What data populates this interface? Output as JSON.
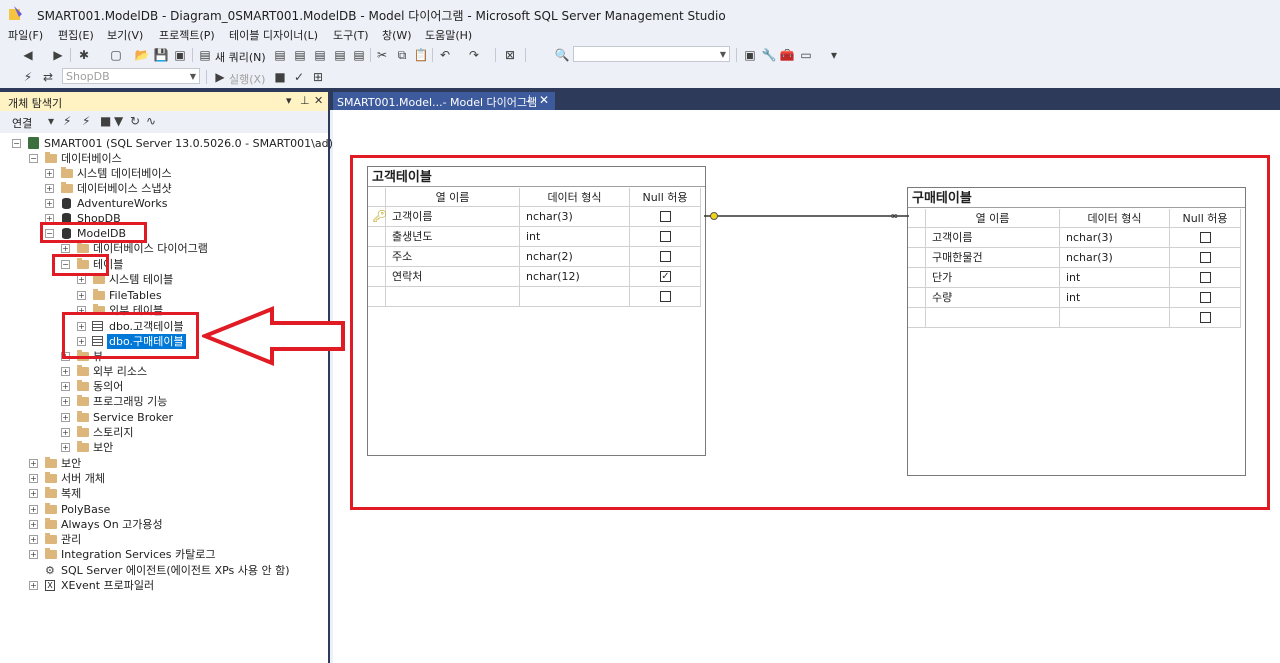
{
  "window": {
    "title": "SMART001.ModelDB - Diagram_0SMART001.ModelDB - Model 다이어그램 - Microsoft SQL Server Management Studio"
  },
  "menu": [
    "파일(F)",
    "편집(E)",
    "보기(V)",
    "프로젝트(P)",
    "테이블 디자이너(L)",
    "도구(T)",
    "창(W)",
    "도움말(H)"
  ],
  "toolbar": {
    "new_query": "새 쿼리(N)",
    "db_combo": "ShopDB",
    "execute": "실행(X)"
  },
  "explorer": {
    "title": "개체 탐색기",
    "connect_label": "연결",
    "server": "SMART001 (SQL Server 13.0.5026.0 - SMART001\\ad)",
    "nodes": {
      "databases": "데이터베이스",
      "system_db": "시스템 데이터베이스",
      "db_snapshot": "데이터베이스 스냅샷",
      "adventureworks": "AdventureWorks",
      "shopdb": "ShopDB",
      "modeldb": "ModelDB",
      "db_diagram": "데이터베이스 다이어그램",
      "tables": "테이블",
      "system_tables": "시스템 테이블",
      "filetables": "FileTables",
      "external_tables": "외부 테이블",
      "dbo_customer": "dbo.고객테이블",
      "dbo_purchase": "dbo.구매테이블",
      "views": "뷰",
      "external_resources": "외부 리소스",
      "synonyms": "동의어",
      "programmability": "프로그래밍 기능",
      "service_broker": "Service Broker",
      "storage": "스토리지",
      "security_db": "보안",
      "security": "보안",
      "server_objects": "서버 개체",
      "replication": "복제",
      "polybase": "PolyBase",
      "always_on": "Always On 고가용성",
      "management": "관리",
      "integration_services": "Integration Services 카탈로그",
      "sql_agent": "SQL Server 에이전트(에이전트 XPs 사용 안 함)",
      "xevent": "XEvent 프로파일러"
    }
  },
  "doc_tab": {
    "label": "SMART001.Model...- Model 다이어그램"
  },
  "diagram": {
    "columns_header": {
      "name": "열 이름",
      "type": "데이터 형식",
      "nullable": "Null 허용"
    },
    "customer_table": {
      "title": "고객테이블",
      "rows": [
        {
          "name": "고객이름",
          "type": "nchar(3)",
          "null": false,
          "pk": true
        },
        {
          "name": "출생년도",
          "type": "int",
          "null": false,
          "pk": false
        },
        {
          "name": "주소",
          "type": "nchar(2)",
          "null": false,
          "pk": false
        },
        {
          "name": "연락처",
          "type": "nchar(12)",
          "null": true,
          "pk": false
        }
      ]
    },
    "purchase_table": {
      "title": "구매테이블",
      "rows": [
        {
          "name": "고객이름",
          "type": "nchar(3)",
          "null": false
        },
        {
          "name": "구매한물건",
          "type": "nchar(3)",
          "null": false
        },
        {
          "name": "단가",
          "type": "int",
          "null": false
        },
        {
          "name": "수량",
          "type": "int",
          "null": false
        }
      ]
    }
  },
  "colors": {
    "annotation_red": "#e01b24",
    "selection_blue": "#0078d7",
    "dark_band": "#2d3a59",
    "panel_header": "#fff3c4"
  }
}
